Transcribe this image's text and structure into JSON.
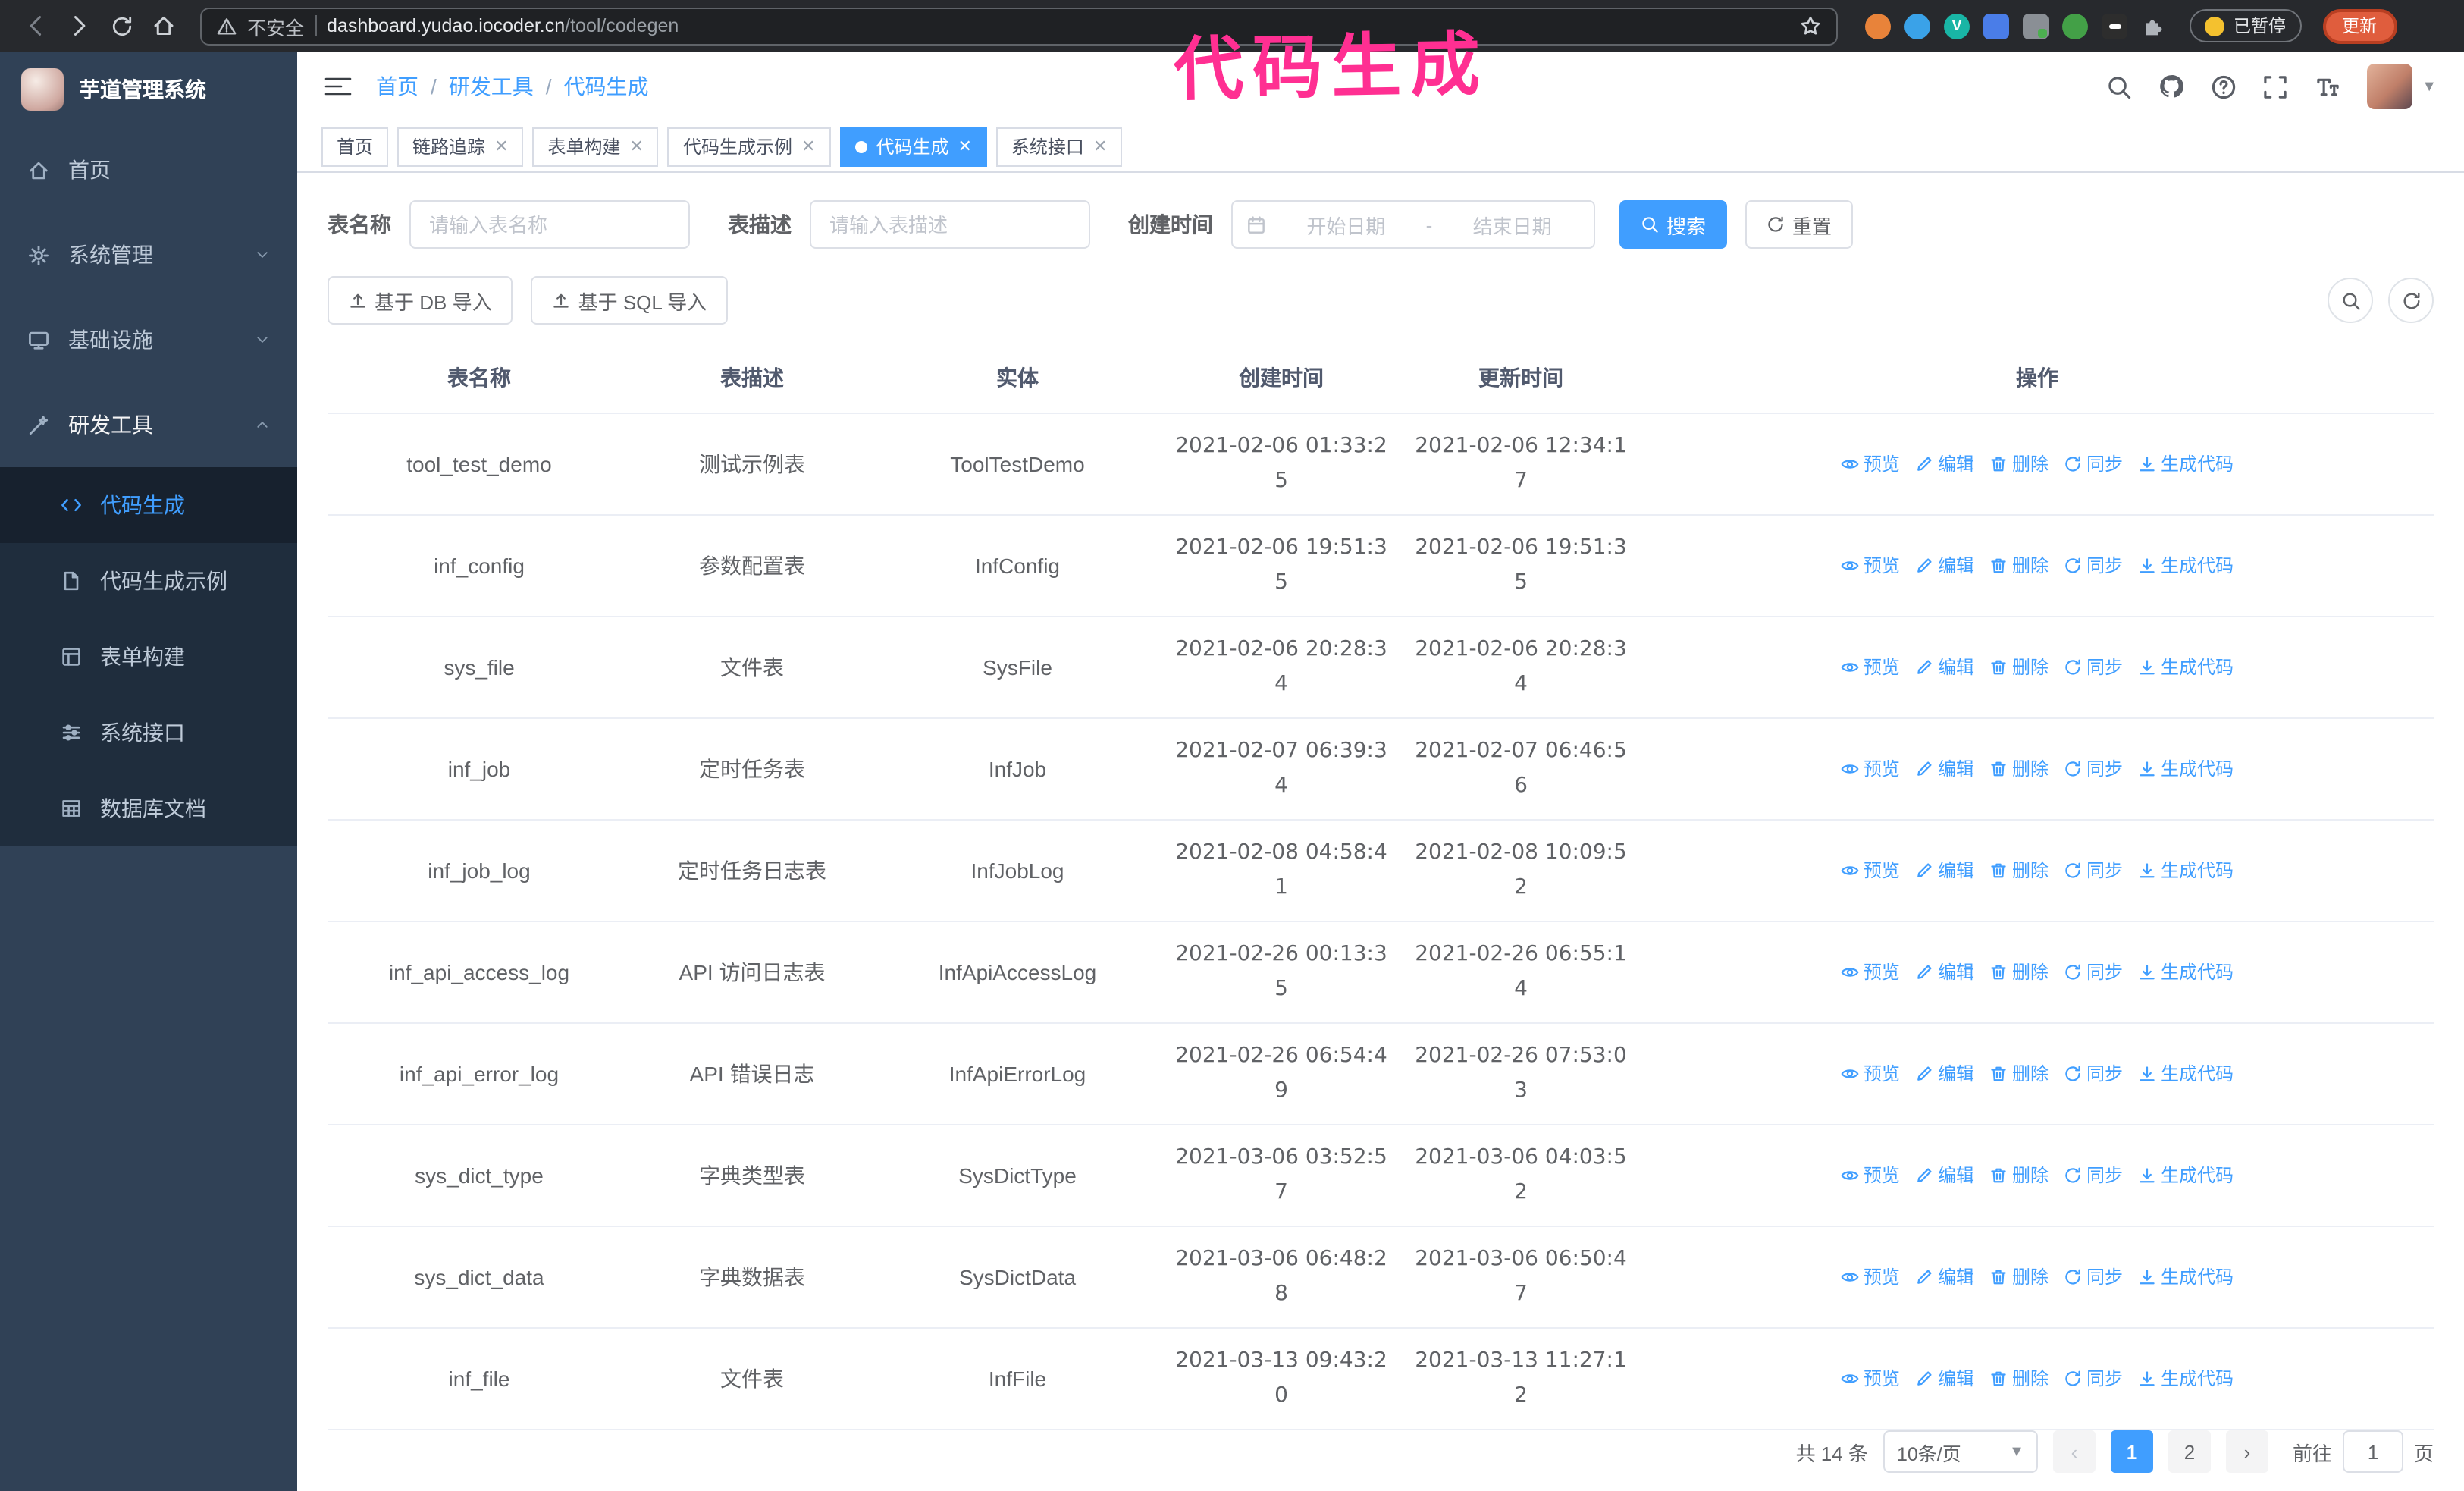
{
  "browser": {
    "security_label": "不安全",
    "url_host": "dashboard.yudao.iocoder.cn",
    "url_path": "/tool/codegen",
    "paused_badge": "已暂停",
    "update_button": "更新"
  },
  "annotation": "代码生成",
  "sidebar": {
    "logo_title": "芋道管理系统",
    "items": [
      {
        "label": "首页"
      },
      {
        "label": "系统管理"
      },
      {
        "label": "基础设施"
      },
      {
        "label": "研发工具"
      }
    ],
    "subitems": [
      {
        "label": "代码生成"
      },
      {
        "label": "代码生成示例"
      },
      {
        "label": "表单构建"
      },
      {
        "label": "系统接口"
      },
      {
        "label": "数据库文档"
      }
    ]
  },
  "navbar": {
    "breadcrumb": [
      "首页",
      "研发工具",
      "代码生成"
    ],
    "breadcrumb_separator": "/"
  },
  "tabs": [
    {
      "label": "首页"
    },
    {
      "label": "链路追踪"
    },
    {
      "label": "表单构建"
    },
    {
      "label": "代码生成示例"
    },
    {
      "label": "代码生成"
    },
    {
      "label": "系统接口"
    }
  ],
  "filters": {
    "name_label": "表名称",
    "name_placeholder": "请输入表名称",
    "desc_label": "表描述",
    "desc_placeholder": "请输入表描述",
    "time_label": "创建时间",
    "start_placeholder": "开始日期",
    "range_separator": "-",
    "end_placeholder": "结束日期",
    "search_button": "搜索",
    "reset_button": "重置"
  },
  "toolbar": {
    "import_db": "基于 DB 导入",
    "import_sql": "基于 SQL 导入"
  },
  "table": {
    "columns": [
      "表名称",
      "表描述",
      "实体",
      "创建时间",
      "更新时间",
      "操作"
    ],
    "actions": [
      "预览",
      "编辑",
      "删除",
      "同步",
      "生成代码"
    ],
    "rows": [
      {
        "name": "tool_test_demo",
        "desc": "测试示例表",
        "entity": "ToolTestDemo",
        "created": "2021-02-06 01:33:25",
        "updated": "2021-02-06 12:34:17"
      },
      {
        "name": "inf_config",
        "desc": "参数配置表",
        "entity": "InfConfig",
        "created": "2021-02-06 19:51:35",
        "updated": "2021-02-06 19:51:35"
      },
      {
        "name": "sys_file",
        "desc": "文件表",
        "entity": "SysFile",
        "created": "2021-02-06 20:28:34",
        "updated": "2021-02-06 20:28:34"
      },
      {
        "name": "inf_job",
        "desc": "定时任务表",
        "entity": "InfJob",
        "created": "2021-02-07 06:39:34",
        "updated": "2021-02-07 06:46:56"
      },
      {
        "name": "inf_job_log",
        "desc": "定时任务日志表",
        "entity": "InfJobLog",
        "created": "2021-02-08 04:58:41",
        "updated": "2021-02-08 10:09:52"
      },
      {
        "name": "inf_api_access_log",
        "desc": "API 访问日志表",
        "entity": "InfApiAccessLog",
        "created": "2021-02-26 00:13:35",
        "updated": "2021-02-26 06:55:14"
      },
      {
        "name": "inf_api_error_log",
        "desc": "API 错误日志",
        "entity": "InfApiErrorLog",
        "created": "2021-02-26 06:54:49",
        "updated": "2021-02-26 07:53:03"
      },
      {
        "name": "sys_dict_type",
        "desc": "字典类型表",
        "entity": "SysDictType",
        "created": "2021-03-06 03:52:57",
        "updated": "2021-03-06 04:03:52"
      },
      {
        "name": "sys_dict_data",
        "desc": "字典数据表",
        "entity": "SysDictData",
        "created": "2021-03-06 06:48:28",
        "updated": "2021-03-06 06:50:47"
      },
      {
        "name": "inf_file",
        "desc": "文件表",
        "entity": "InfFile",
        "created": "2021-03-13 09:43:20",
        "updated": "2021-03-13 11:27:12"
      }
    ]
  },
  "pagination": {
    "total": "共 14 条",
    "page_size": "10条/页",
    "pages": [
      "1",
      "2"
    ],
    "goto_label": "前往",
    "goto_value": "1",
    "goto_suffix": "页"
  },
  "colors": {
    "primary": "#409eff",
    "annotation_pink": "#ff2f92",
    "sidebar_bg": "#304156",
    "submenu_bg": "#1f2d3d"
  }
}
